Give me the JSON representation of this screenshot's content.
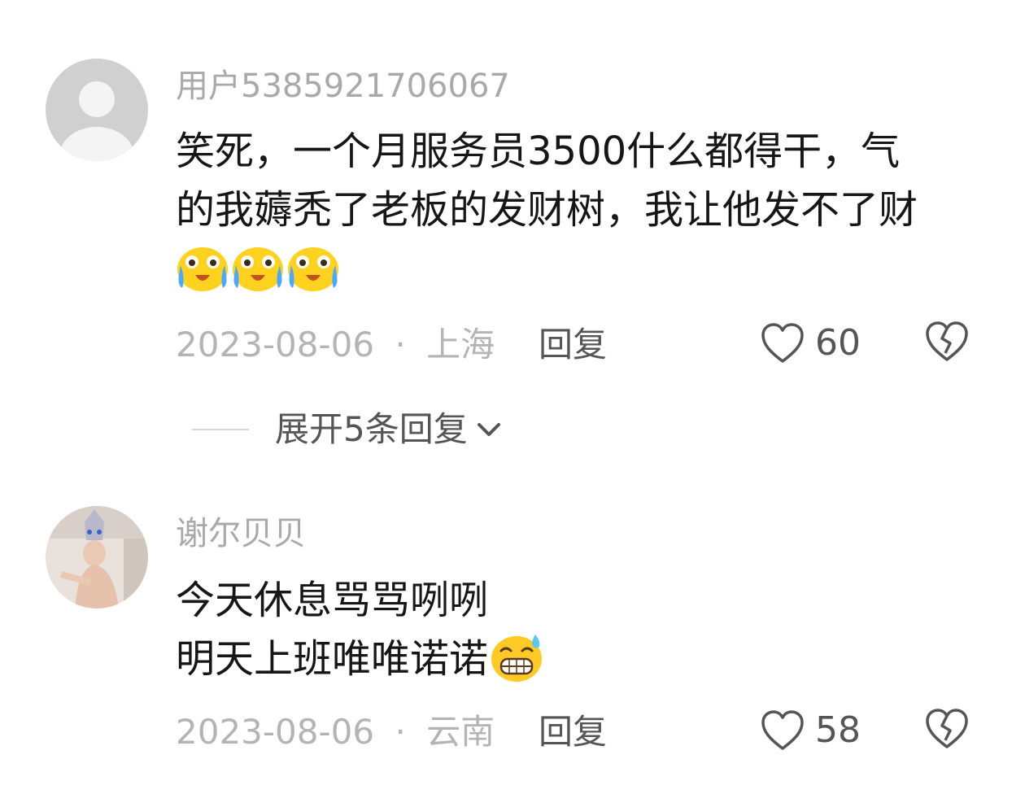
{
  "comments": [
    {
      "username": "用户5385921706067",
      "text_lines": [
        "笑死，一个月服务员3500什么都得干，气",
        "的我薅秃了老板的发财树，我让他发不了财"
      ],
      "emojis": [
        "crying-emoji",
        "crying-emoji",
        "crying-emoji"
      ],
      "date": "2023-08-06",
      "separator": "·",
      "location": "上海",
      "reply_label": "回复",
      "likes": "60"
    },
    {
      "username": "谢尔贝贝",
      "text_lines": [
        "今天休息骂骂咧咧",
        "明天上班唯唯诺诺"
      ],
      "emojis": [
        "sweat-grin-emoji"
      ],
      "date": "2023-08-06",
      "separator": "·",
      "location": "云南",
      "reply_label": "回复",
      "likes": "58"
    }
  ],
  "expand_replies": {
    "label": "展开5条回复"
  },
  "colors": {
    "username": "#a9a9a9",
    "text": "#161616",
    "meta": "#b4b4b4",
    "action": "#555555"
  }
}
